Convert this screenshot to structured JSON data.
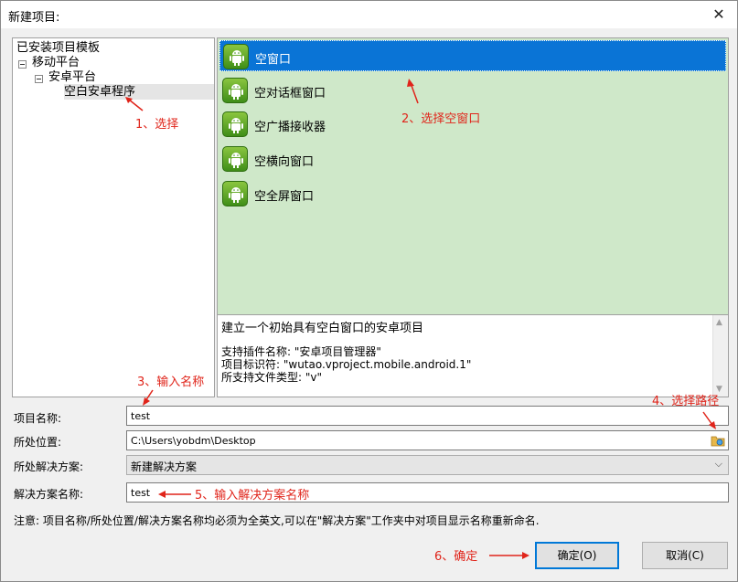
{
  "window": {
    "title": "新建项目:",
    "close_symbol": "✕"
  },
  "tree": {
    "root": "已安装项目模板",
    "node1": "移动平台",
    "node2": "安卓平台",
    "leaf": "空白安卓程序"
  },
  "templates": [
    {
      "label": "空窗口"
    },
    {
      "label": "空对话框窗口"
    },
    {
      "label": "空广播接收器"
    },
    {
      "label": "空横向窗口"
    },
    {
      "label": "空全屏窗口"
    }
  ],
  "description": {
    "line1": "建立一个初始具有空白窗口的安卓项目",
    "line2": "支持插件名称: \"安卓项目管理器\"",
    "line3": "项目标识符: \"wutao.vproject.mobile.android.1\"",
    "line4": "所支持文件类型: \"v\""
  },
  "form": {
    "project_name_label": "项目名称:",
    "project_name_value": "test",
    "location_label": "所处位置:",
    "location_value": "C:\\Users\\yobdm\\Desktop",
    "solution_label": "所处解决方案:",
    "solution_value": "新建解决方案",
    "solution_name_label": "解决方案名称:",
    "solution_name_value": "test"
  },
  "note": "注意: 项目名称/所处位置/解决方案名称均必须为全英文,可以在\"解决方案\"工作夹中对项目显示名称重新命名.",
  "buttons": {
    "ok": "确定(O)",
    "cancel": "取消(C)"
  },
  "annotations": {
    "a1": "1、选择",
    "a2": "2、选择空窗口",
    "a3": "3、输入名称",
    "a4": "4、选择路径",
    "a5": "5、输入解决方案名称",
    "a6": "6、确定"
  },
  "colors": {
    "selection": "#0a74d6",
    "template_bg": "#cfe8c9",
    "annotation": "#e0241a",
    "primary_border": "#0078d7"
  }
}
